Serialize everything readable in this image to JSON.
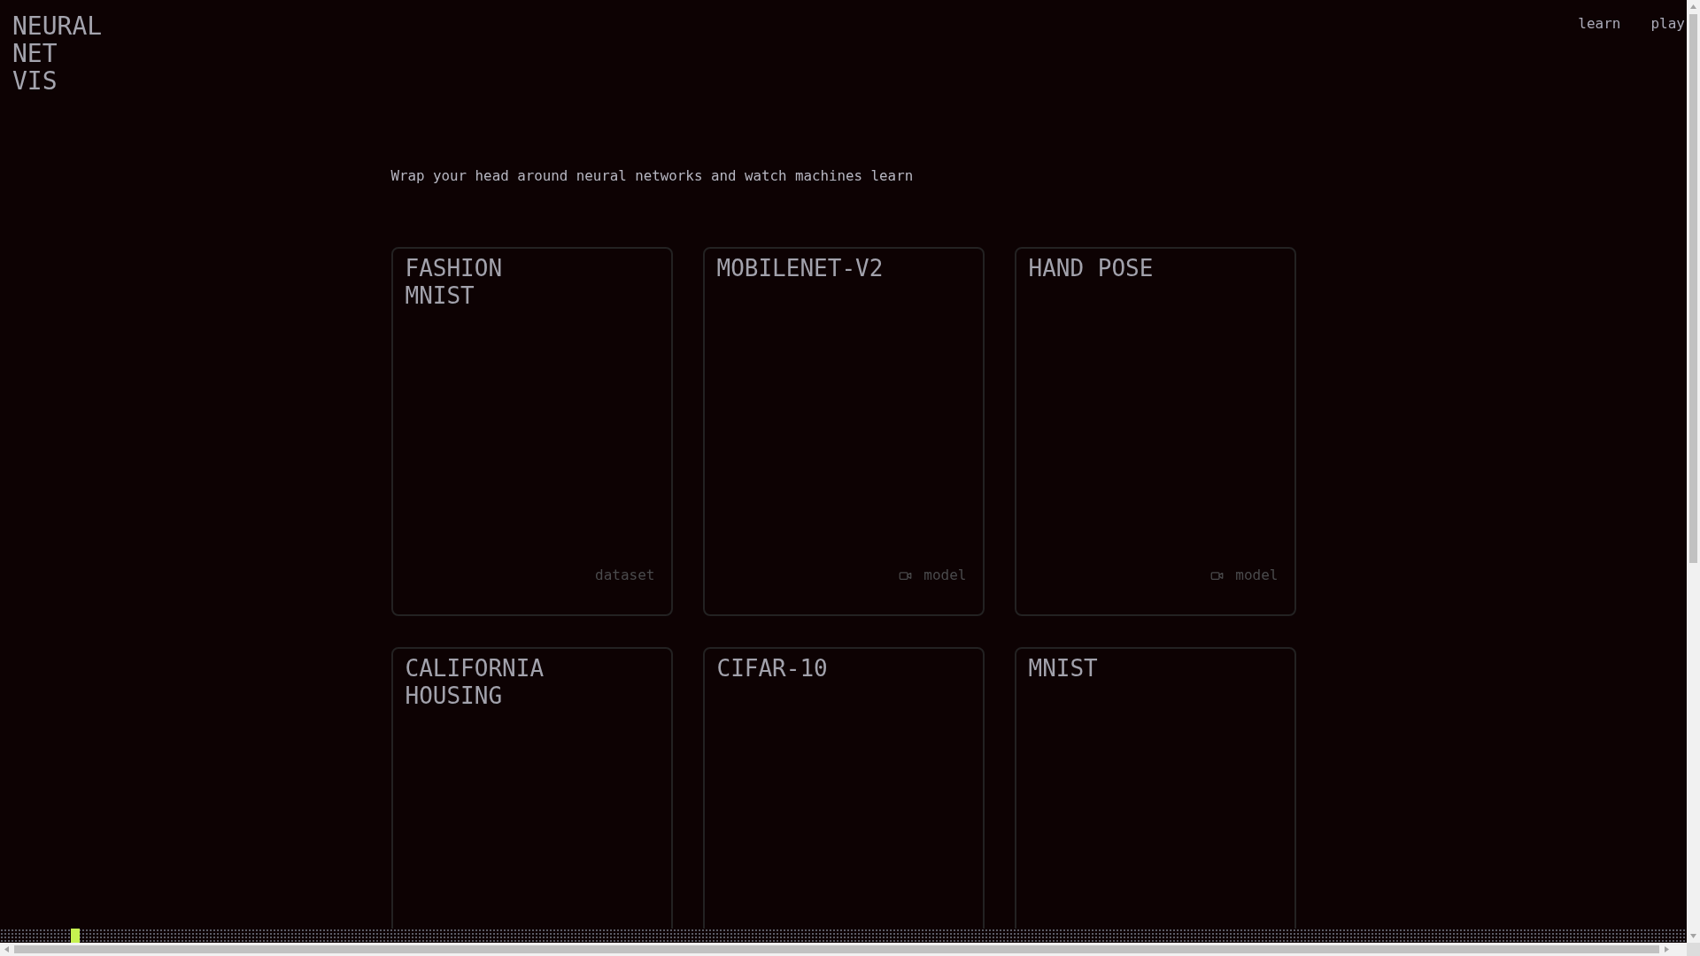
{
  "logo": {
    "text": "NEURAL NET VIS"
  },
  "nav": [
    {
      "label": "learn"
    },
    {
      "label": "play"
    }
  ],
  "tagline": "Wrap your head around neural networks and watch machines learn",
  "cards": [
    {
      "title": "FASHION MNIST",
      "tag": {
        "label": "dataset",
        "camera_icon": false
      }
    },
    {
      "title": "MOBILENET-V2",
      "tag": {
        "label": "model",
        "camera_icon": true
      }
    },
    {
      "title": "HAND POSE",
      "tag": {
        "label": "model",
        "camera_icon": true
      }
    },
    {
      "title": "CALIFORNIA HOUSING"
    },
    {
      "title": "CIFAR-10"
    },
    {
      "title": "MNIST"
    }
  ],
  "bottom_strip": {
    "level": 0.042
  }
}
